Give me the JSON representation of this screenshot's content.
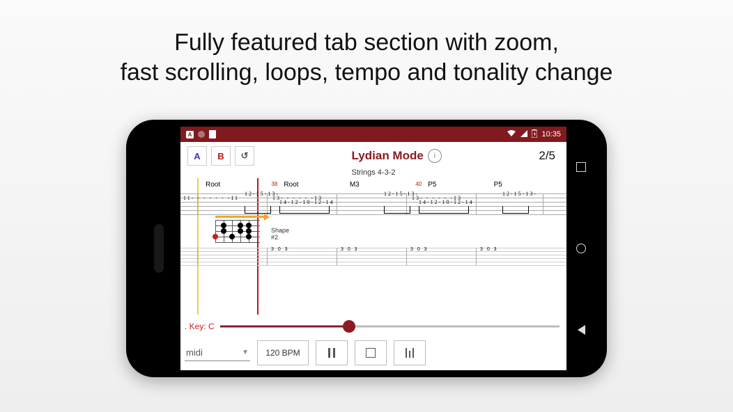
{
  "headline": {
    "line1": "Fully featured tab section with zoom,",
    "line2": "fast scrolling, loops, tempo and tonality change"
  },
  "status": {
    "time": "10:35"
  },
  "toolbar": {
    "loop_a": "A",
    "loop_b": "B",
    "reset_glyph": "↺",
    "info_glyph": "i"
  },
  "title": {
    "main": "Lydian Mode",
    "sub": "Strings 4-3-2",
    "page": "2/5"
  },
  "tab": {
    "labels": [
      "Root",
      "38",
      "Root",
      "M3",
      "40",
      "P5",
      "P5"
    ],
    "shape_label": "Shape #2",
    "fragments": {
      "f1": "11- - - - - - -11",
      "f2": "12-15-13-",
      "f3": "13- - - - - -13",
      "f4": "14-12-10-12-14",
      "f5": "12-15-13-",
      "f6": "13- - - - - -13",
      "f7": "14-12-10-12-14",
      "f8": "12-15-13-",
      "lower_nums": "3 0 3"
    }
  },
  "playback": {
    "key_label": ". Key: C",
    "slider_pct": 38,
    "output": "midi",
    "tempo": "120 BPM"
  }
}
